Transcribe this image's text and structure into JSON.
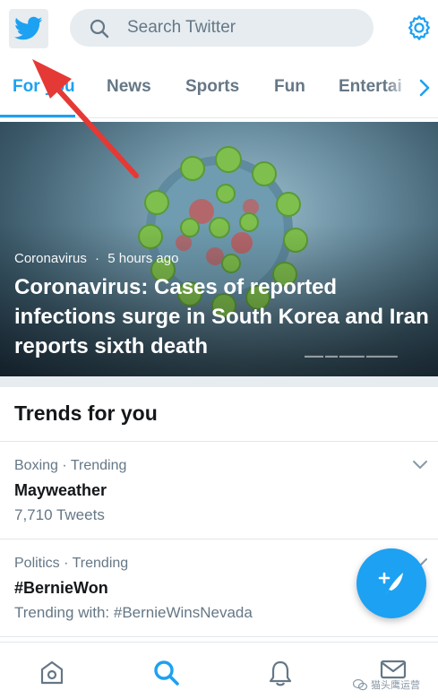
{
  "header": {
    "search_placeholder": "Search Twitter"
  },
  "tabs": [
    {
      "label": "For you",
      "active": true
    },
    {
      "label": "News",
      "active": false
    },
    {
      "label": "Sports",
      "active": false
    },
    {
      "label": "Fun",
      "active": false
    },
    {
      "label": "Entertai",
      "active": false
    }
  ],
  "hero": {
    "category": "Coronavirus",
    "separator": "·",
    "time": "5 hours ago",
    "title": "Coronavirus: Cases of reported infections surge in South Korea and Iran reports sixth death"
  },
  "trends": {
    "title": "Trends for you",
    "items": [
      {
        "context": "Boxing · Trending",
        "name": "Mayweather",
        "sub": "7,710 Tweets"
      },
      {
        "context": "Politics · Trending",
        "name": "#BernieWon",
        "sub": "Trending with: #BernieWinsNevada"
      }
    ]
  },
  "bottom_nav": {
    "icons": [
      "home-icon",
      "search-icon",
      "notifications-icon",
      "messages-icon"
    ],
    "active": "search-icon"
  },
  "watermark": {
    "text": "猫头鹰运营"
  },
  "colors": {
    "accent": "#1da1f2",
    "secondary_text": "#657786",
    "annotation_arrow": "#e53935"
  },
  "icons": {
    "logo": "twitter-bird-icon",
    "search": "search-icon",
    "settings": "gear-icon",
    "tab_scroll": "chevron-right-icon",
    "trend_menu": "chevron-down-icon",
    "compose": "compose-tweet-icon"
  }
}
